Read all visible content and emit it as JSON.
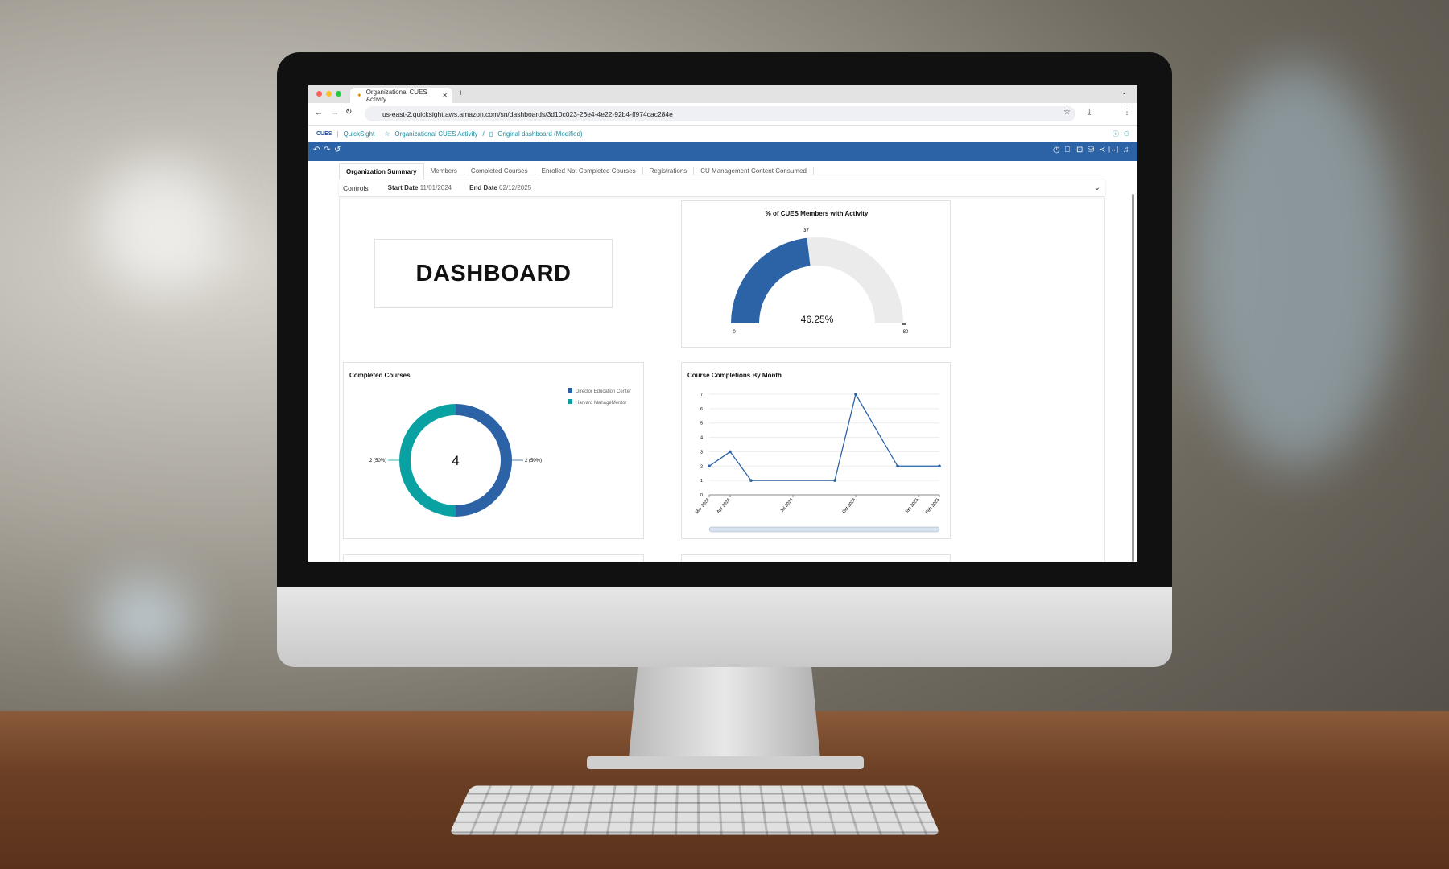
{
  "browser": {
    "tab_title": "Organizational CUES Activity",
    "url": "us-east-2.quicksight.aws.amazon.com/sn/dashboards/3d10c023-26e4-4e22-92b4-ff974cac284e"
  },
  "quicksight": {
    "logo": "CUES",
    "app": "QuickSight",
    "breadcrumb_dashboard": "Organizational CUES Activity",
    "breadcrumb_sep": "/",
    "breadcrumb_sheet": "Original dashboard (Modified)"
  },
  "sheet_tabs": [
    "Organization Summary",
    "Members",
    "Completed Courses",
    "Enrolled Not Completed Courses",
    "Registrations",
    "CU Management Content Consumed"
  ],
  "controls": {
    "label": "Controls",
    "start_label": "Start Date",
    "start_value": "11/01/2024",
    "end_label": "End Date",
    "end_value": "02/12/2025"
  },
  "dashboard_text": "DASHBOARD",
  "gauge": {
    "title": "% of CUES Members with Activity",
    "value": 37,
    "min": 0,
    "max": 80,
    "min_label": "0",
    "max_label": "80",
    "value_label": "37",
    "percent_label": "46.25%",
    "fill_color": "#2b63a6",
    "track_color": "#ebebeb"
  },
  "chart_data": [
    {
      "type": "pie",
      "title": "Completed Courses",
      "center_label": "4",
      "series": [
        {
          "name": "Director Education Center",
          "value": 2,
          "label": "2 (50%)",
          "color": "#2b63a6"
        },
        {
          "name": "Harvard ManageMentor",
          "value": 2,
          "label": "2 (50%)",
          "color": "#0aa1a3"
        }
      ],
      "legend": "top-right"
    },
    {
      "type": "line",
      "title": "Course Completions By Month",
      "x": [
        "Mar 2024",
        "Apr 2024",
        "May 2024",
        "Sep 2024",
        "Oct 2024",
        "Dec 2024",
        "Feb 2025"
      ],
      "y": [
        2,
        3,
        1,
        1,
        7,
        2,
        2
      ],
      "xticks": [
        "Mar 2024",
        "Apr 2024",
        "Jul 2024",
        "Oct 2024",
        "Jan 2025",
        "Feb 2025"
      ],
      "yticks": [
        "0",
        "1",
        "2",
        "3",
        "4",
        "5",
        "6",
        "7"
      ],
      "xlim": [
        "Mar 2024",
        "Feb 2025"
      ],
      "ylim": [
        0,
        7
      ],
      "grid": true,
      "color": "#2b63a6"
    }
  ]
}
